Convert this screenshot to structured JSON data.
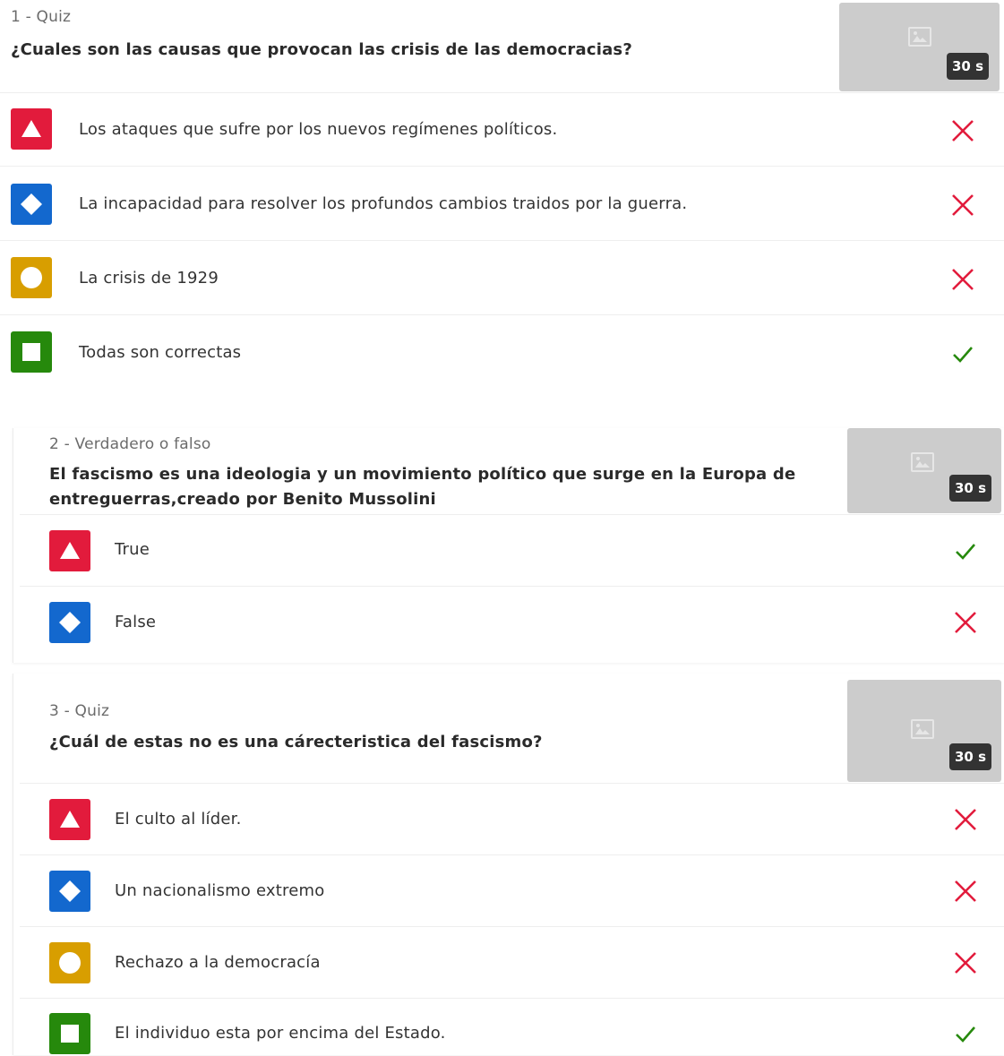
{
  "colors": {
    "triangle": "#e21b3c",
    "diamond": "#1368ce",
    "circle": "#d89e00",
    "square": "#26890c",
    "correct": "#26890c",
    "incorrect": "#e21b3c"
  },
  "questions": [
    {
      "type_label": "1 - Quiz",
      "text": "¿Cuales son las causas que provocan las crisis de las democracias?",
      "time": "30 s",
      "answers": [
        {
          "shape": "triangle-icon",
          "text": "Los ataques que sufre por los nuevos regímenes políticos.",
          "correct": false
        },
        {
          "shape": "diamond-icon",
          "text": "La incapacidad para resolver los profundos cambios traidos por la guerra.",
          "correct": false
        },
        {
          "shape": "circle-icon",
          "text": "La crisis de 1929",
          "correct": false
        },
        {
          "shape": "square-icon",
          "text": "Todas son correctas",
          "correct": true
        }
      ]
    },
    {
      "type_label": "2 - Verdadero o falso",
      "text_line1": "El fascismo es una ideologia y un movimiento político que surge en la Europa de",
      "text_line2": "entreguerras,creado por Benito Mussolini",
      "time": "30 s",
      "answers": [
        {
          "shape": "triangle-icon",
          "text": "True",
          "correct": true
        },
        {
          "shape": "diamond-icon",
          "text": "False",
          "correct": false
        }
      ]
    },
    {
      "type_label": "3 - Quiz",
      "text": "¿Cuál de estas no es una cárecteristica del fascismo?",
      "time": "30 s",
      "answers": [
        {
          "shape": "triangle-icon",
          "text": "El culto al líder.",
          "correct": false
        },
        {
          "shape": "diamond-icon",
          "text": "Un nacionalismo extremo",
          "correct": false
        },
        {
          "shape": "circle-icon",
          "text": "Rechazo a la democracía",
          "correct": false
        },
        {
          "shape": "square-icon",
          "text": "El individuo esta por encima del Estado.",
          "correct": true
        }
      ]
    }
  ]
}
